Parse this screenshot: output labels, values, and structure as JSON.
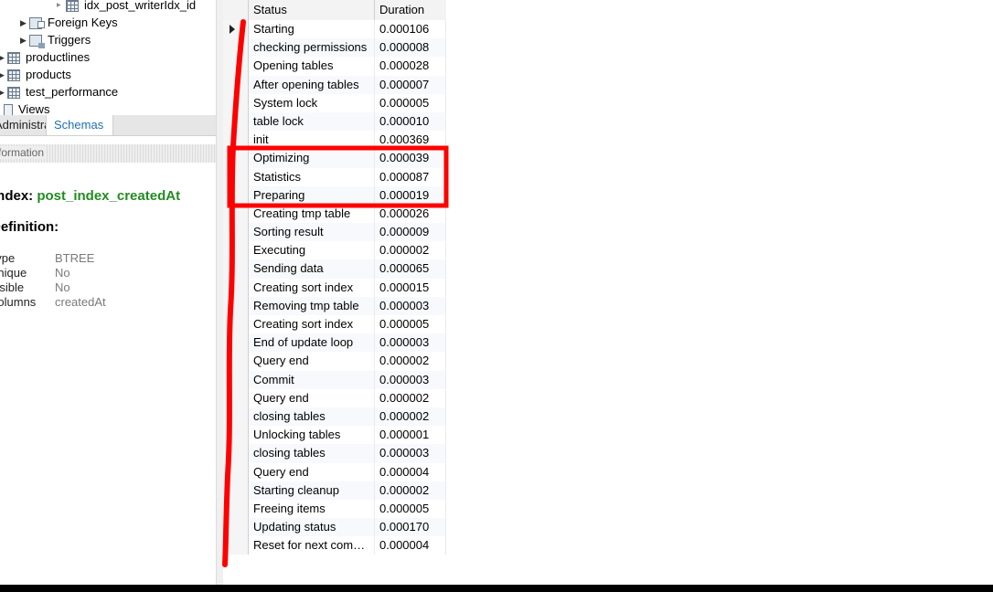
{
  "navigator": {
    "tree_items": [
      {
        "label": "idx_post_writerIdx_id",
        "icon": "index-icon",
        "indent": 62,
        "expander": "collapsed-small"
      },
      {
        "label": "Foreign Keys",
        "icon": "foreign-keys-icon",
        "indent": 22,
        "expander": "collapsed"
      },
      {
        "label": "Triggers",
        "icon": "triggers-icon",
        "indent": 22,
        "expander": "collapsed"
      },
      {
        "label": "productlines",
        "icon": "table-icon",
        "indent": -2,
        "expander": "collapsed"
      },
      {
        "label": "products",
        "icon": "table-icon",
        "indent": -2,
        "expander": "collapsed"
      },
      {
        "label": "test_performance",
        "icon": "table-icon",
        "indent": -2,
        "expander": "collapsed"
      },
      {
        "label": "Views",
        "icon": "views-icon",
        "indent": -6,
        "expander": "none"
      }
    ],
    "tabs": {
      "administration": "Administration",
      "schemas": "Schemas"
    }
  },
  "info_panel": {
    "header": "Information",
    "index_prefix": "Index: ",
    "index_name": "post_index_createdAt",
    "definition_label": "Definition:",
    "properties": [
      {
        "label": "Type",
        "value": "BTREE"
      },
      {
        "label": "Unique",
        "value": "No"
      },
      {
        "label": "Visible",
        "value": "No"
      },
      {
        "label": "Columns",
        "value": "createdAt"
      }
    ]
  },
  "result_grid": {
    "columns": [
      "Status",
      "Duration"
    ],
    "rows": [
      {
        "status": "Starting",
        "duration": "0.000106"
      },
      {
        "status": "checking permissions",
        "duration": "0.000008"
      },
      {
        "status": "Opening tables",
        "duration": "0.000028"
      },
      {
        "status": "After opening tables",
        "duration": "0.000007"
      },
      {
        "status": "System lock",
        "duration": "0.000005"
      },
      {
        "status": "table lock",
        "duration": "0.000010"
      },
      {
        "status": "init",
        "duration": "0.000369"
      },
      {
        "status": "Optimizing",
        "duration": "0.000039"
      },
      {
        "status": "Statistics",
        "duration": "0.000087"
      },
      {
        "status": "Preparing",
        "duration": "0.000019"
      },
      {
        "status": "Creating tmp table",
        "duration": "0.000026"
      },
      {
        "status": "Sorting result",
        "duration": "0.000009"
      },
      {
        "status": "Executing",
        "duration": "0.000002"
      },
      {
        "status": "Sending data",
        "duration": "0.000065"
      },
      {
        "status": "Creating sort index",
        "duration": "0.000015"
      },
      {
        "status": "Removing tmp table",
        "duration": "0.000003"
      },
      {
        "status": "Creating sort index",
        "duration": "0.000005"
      },
      {
        "status": "End of update loop",
        "duration": "0.000003"
      },
      {
        "status": "Query end",
        "duration": "0.000002"
      },
      {
        "status": "Commit",
        "duration": "0.000003"
      },
      {
        "status": "Query end",
        "duration": "0.000002"
      },
      {
        "status": "closing tables",
        "duration": "0.000002"
      },
      {
        "status": "Unlocking tables",
        "duration": "0.000001"
      },
      {
        "status": "closing tables",
        "duration": "0.000003"
      },
      {
        "status": "Query end",
        "duration": "0.000004"
      },
      {
        "status": "Starting cleanup",
        "duration": "0.000002"
      },
      {
        "status": "Freeing items",
        "duration": "0.000005"
      },
      {
        "status": "Updating status",
        "duration": "0.000170"
      },
      {
        "status": "Reset for next command",
        "duration": "0.000004"
      }
    ]
  },
  "annotations": {
    "color": "#ff0000"
  }
}
